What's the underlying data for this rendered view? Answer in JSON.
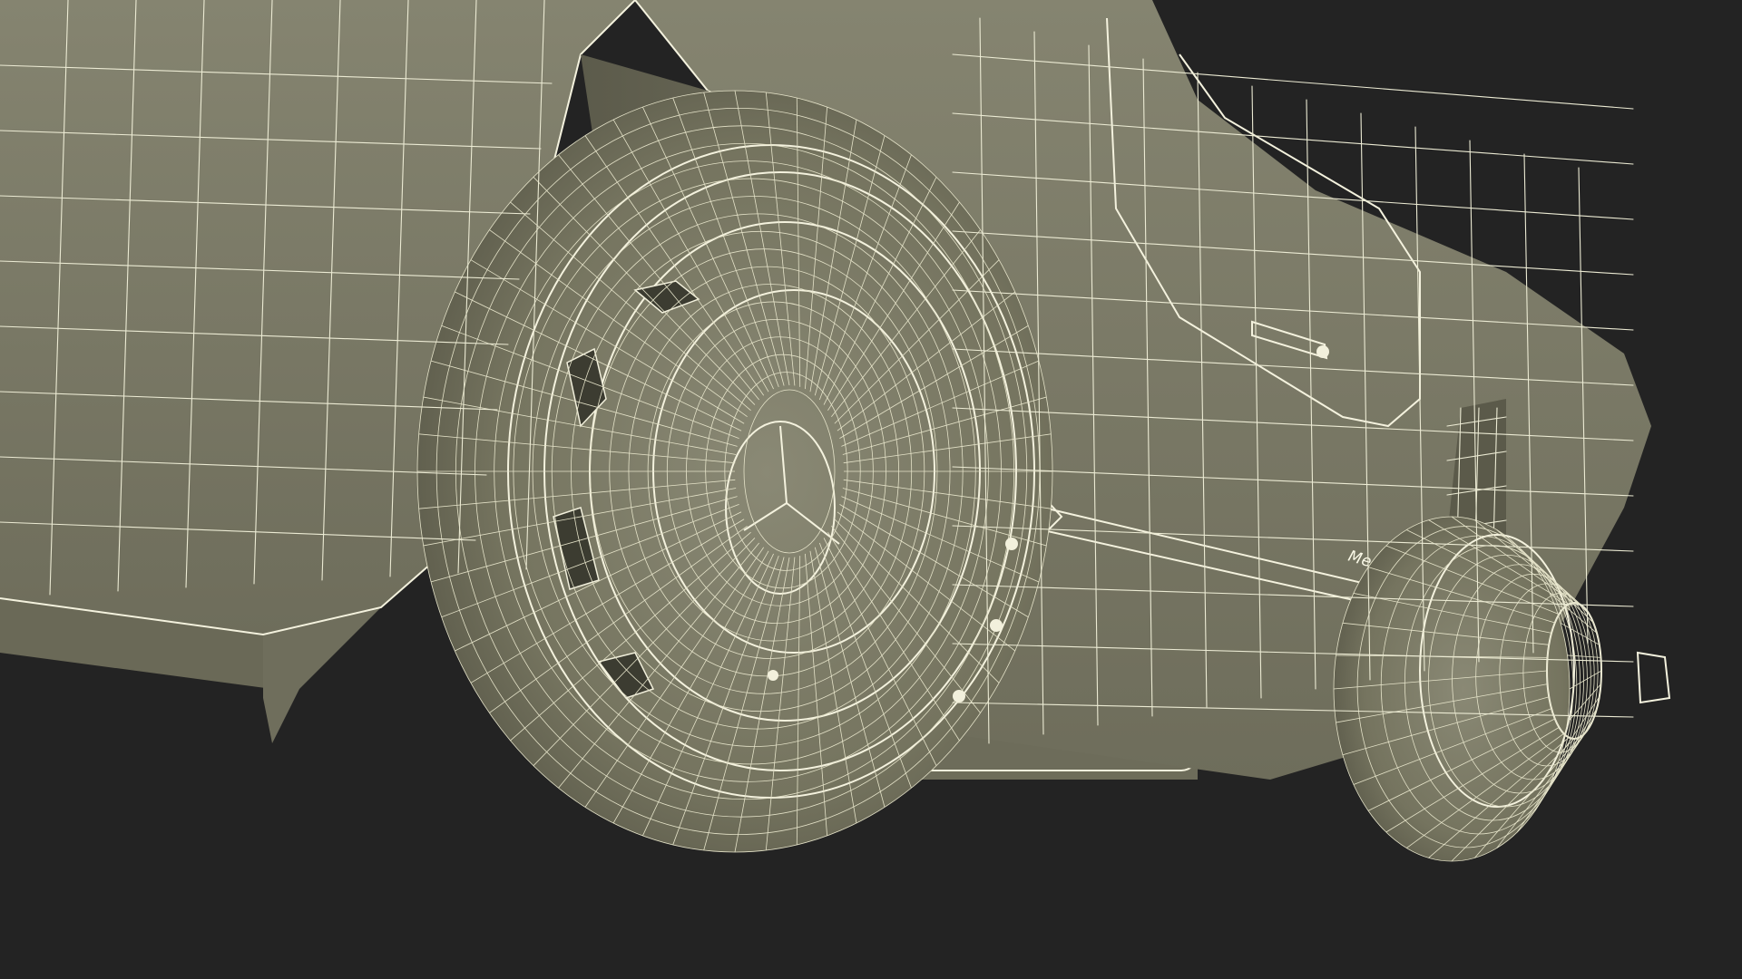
{
  "scene": {
    "subject": "wireframe-render",
    "background_color": "#232323",
    "mesh_surface_color": "#7b7a68",
    "mesh_shadow_color": "#4a4a3e",
    "wire_color": "#ecebd4"
  },
  "emblem": {
    "text": "Mercedes Benz"
  }
}
